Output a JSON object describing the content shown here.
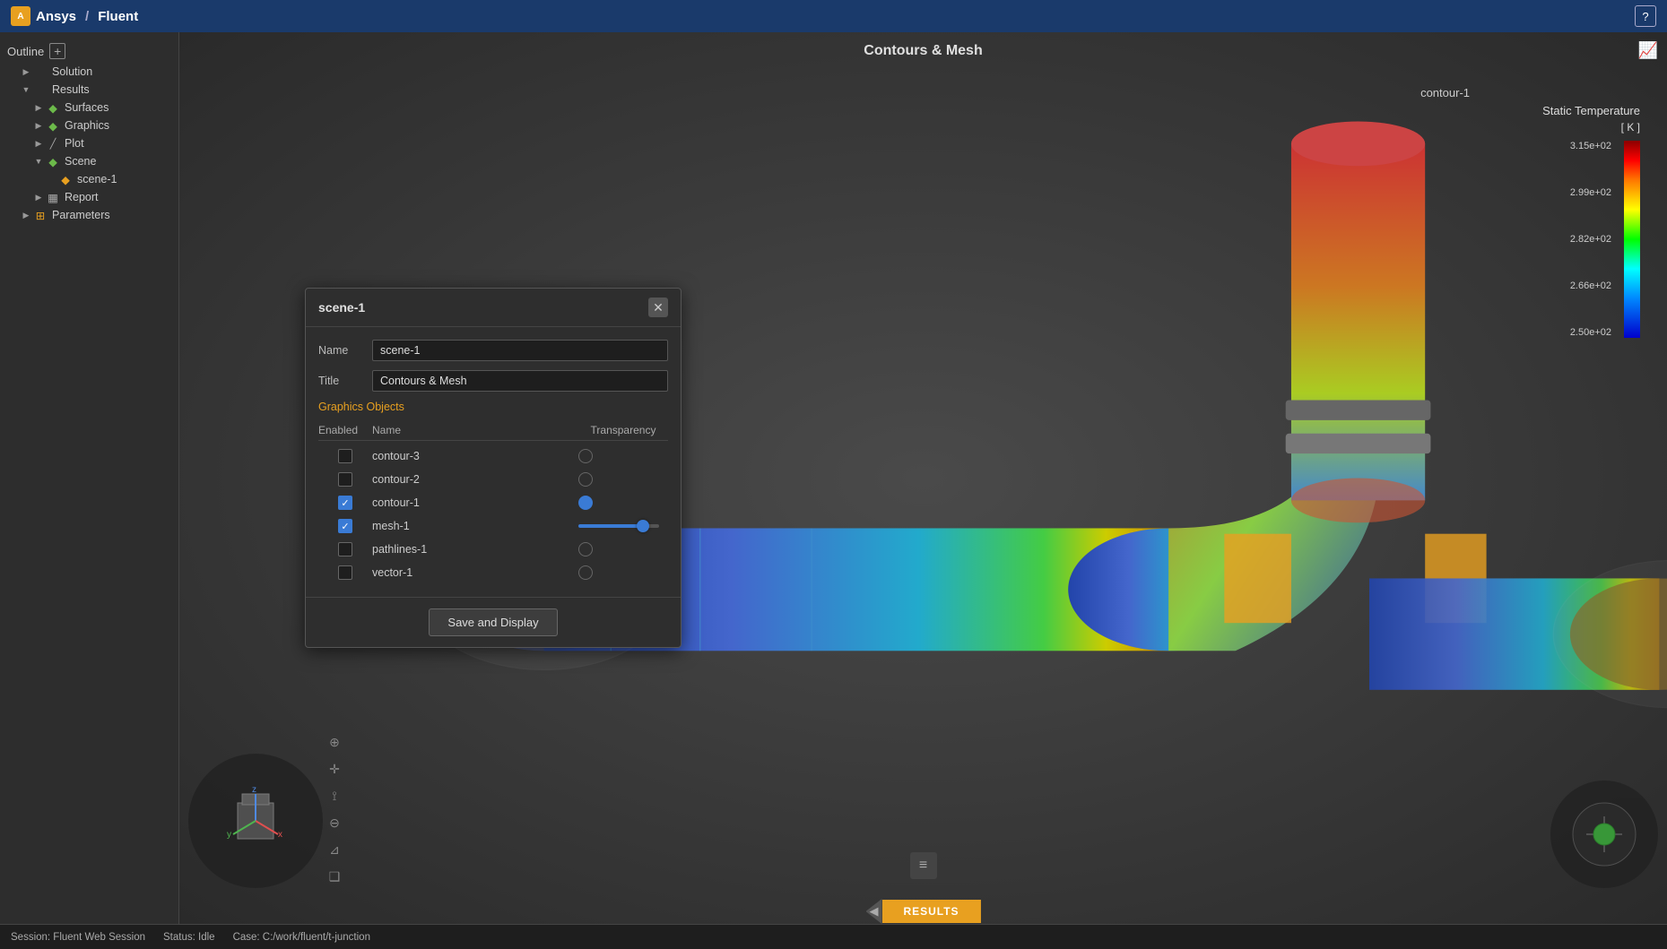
{
  "app": {
    "title": "Fluent",
    "brand": "Ansys"
  },
  "topbar": {
    "logo_text": "Ansys",
    "separator": "/",
    "app_name": "Fluent",
    "help_icon": "?"
  },
  "sidebar": {
    "header": "Outline",
    "add_icon": "+",
    "items": [
      {
        "label": "Solution",
        "indent": 1,
        "arrow": "▶",
        "icon": ""
      },
      {
        "label": "Results",
        "indent": 1,
        "arrow": "▼",
        "icon": ""
      },
      {
        "label": "Surfaces",
        "indent": 2,
        "arrow": "▶",
        "icon": "◆"
      },
      {
        "label": "Graphics",
        "indent": 2,
        "arrow": "▶",
        "icon": "◆"
      },
      {
        "label": "Plot",
        "indent": 2,
        "arrow": "▶",
        "icon": ""
      },
      {
        "label": "Scene",
        "indent": 2,
        "arrow": "▼",
        "icon": "◆"
      },
      {
        "label": "scene-1",
        "indent": 3,
        "arrow": "",
        "icon": "◆"
      },
      {
        "label": "Report",
        "indent": 2,
        "arrow": "▶",
        "icon": ""
      },
      {
        "label": "Parameters",
        "indent": 1,
        "arrow": "▶",
        "icon": ""
      }
    ]
  },
  "viewport": {
    "title": "Contours & Mesh"
  },
  "colorbar": {
    "name": "contour-1",
    "field_label": "Static Temperature",
    "unit": "[ K ]",
    "values": [
      "3.15e+02",
      "2.99e+02",
      "2.82e+02",
      "2.66e+02",
      "2.50e+02"
    ]
  },
  "results_tab": {
    "label": "RESULTS"
  },
  "dialog": {
    "title": "scene-1",
    "name_label": "Name",
    "name_value": "scene-1",
    "title_label": "Title",
    "title_value": "Contours & Mesh",
    "section_label": "Graphics Objects",
    "col_enabled": "Enabled",
    "col_name": "Name",
    "col_trans": "Transparency",
    "rows": [
      {
        "enabled": false,
        "name": "contour-3",
        "trans_type": "circle",
        "slider_pct": 0
      },
      {
        "enabled": false,
        "name": "contour-2",
        "trans_type": "circle",
        "slider_pct": 0
      },
      {
        "enabled": true,
        "name": "contour-1",
        "trans_type": "circle_active",
        "slider_pct": 0
      },
      {
        "enabled": true,
        "name": "mesh-1",
        "trans_type": "slider",
        "slider_pct": 80
      },
      {
        "enabled": false,
        "name": "pathlines-1",
        "trans_type": "circle",
        "slider_pct": 0
      },
      {
        "enabled": false,
        "name": "vector-1",
        "trans_type": "circle",
        "slider_pct": 0
      }
    ],
    "save_button": "Save and Display"
  },
  "statusbar": {
    "session": "Session: Fluent Web Session",
    "status": "Status: Idle",
    "case": "Case: C:/work/fluent/t-junction"
  }
}
